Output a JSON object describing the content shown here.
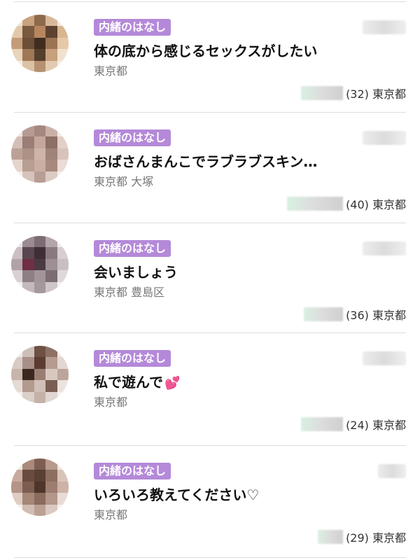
{
  "feed": {
    "items": [
      {
        "tag": "内緒のはなし",
        "title": "体の底から感じるセックスがしたい",
        "location": "東京都",
        "age_location": "(32) 東京都",
        "avatar_colors": [
          "#f0e4d6",
          "#c9a27f",
          "#8c6a4c",
          "#d9b89a",
          "#f3e9df",
          "#e3c9ac",
          "#7a5a3e",
          "#b7865f",
          "#5c4330",
          "#d8b690",
          "#c49c79",
          "#6d4e36",
          "#3f2c1e",
          "#9c7453",
          "#e6c9a8",
          "#e9d4bd",
          "#a07858",
          "#55402e",
          "#c7a07d",
          "#f1e2cf",
          "#f5ede4",
          "#dcc2a5",
          "#b59172",
          "#e2cbb2",
          "#f7efe6"
        ]
      },
      {
        "tag": "内緒のはなし",
        "title": "おばさんまんこでラブラブスキン…",
        "location": "東京都 大塚",
        "age_location": "(40) 東京都",
        "avatar_colors": [
          "#efe6e2",
          "#b69b94",
          "#a58880",
          "#c9b1a8",
          "#f2ebe8",
          "#d4bfb7",
          "#9a7d74",
          "#c5a79c",
          "#8d6f66",
          "#e1cfc8",
          "#bca198",
          "#ad9186",
          "#cdb5aa",
          "#9f847a",
          "#d8c3ba",
          "#e4d4cc",
          "#b89e93",
          "#c9afa3",
          "#a9897d",
          "#eadcd5",
          "#f4eeeb",
          "#d6c4bc",
          "#b79e94",
          "#dccbc3",
          "#f6f0ed"
        ]
      },
      {
        "tag": "内緒のはなし",
        "title": "会いましょう",
        "location": "東京都 豊島区",
        "age_location": "(36) 東京都",
        "avatar_colors": [
          "#e9e6e8",
          "#9a8c92",
          "#7e6b73",
          "#b3a6aa",
          "#eeebec",
          "#cbbfc3",
          "#5a4650",
          "#3e2f37",
          "#8a7a80",
          "#d7ced1",
          "#b1a3a8",
          "#6f2f45",
          "#4a3a42",
          "#9d8f94",
          "#c9bfc2",
          "#d8d0d3",
          "#8e7f86",
          "#a29499",
          "#7b6d73",
          "#e0d9dc",
          "#f1eef0",
          "#c4b9bd",
          "#a5989d",
          "#cfc6c9",
          "#f4f2f3"
        ]
      },
      {
        "tag": "内緒のはなし",
        "title": "私で遊んで",
        "title_emoji": "💕",
        "location": "東京都",
        "age_location": "(24) 東京都",
        "avatar_colors": [
          "#f0ebe8",
          "#cdbfb8",
          "#6e5044",
          "#8e7064",
          "#efe8e4",
          "#d8cbc4",
          "#a89088",
          "#5a3c31",
          "#b69b90",
          "#e4d7d1",
          "#c7b4ab",
          "#3b2620",
          "#9a7e73",
          "#d9c8c0",
          "#bca69c",
          "#e5dad5",
          "#b39a8f",
          "#d1c0b8",
          "#7a5e53",
          "#ece3df",
          "#f5f1ef",
          "#dcd0ca",
          "#c4b1a8",
          "#e1d6d1",
          "#f7f3f1"
        ]
      },
      {
        "tag": "内緒のはなし",
        "title": "いろいろ教えてください♡",
        "location": "東京都",
        "age_location": "(29) 東京都",
        "avatar_colors": [
          "#f0e9e5",
          "#a98a7c",
          "#7d5e50",
          "#b89a8c",
          "#eee7e3",
          "#c7ab9e",
          "#6a4c3f",
          "#5a3f33",
          "#8d6f61",
          "#d9c4ba",
          "#b39486",
          "#7c5d4f",
          "#4e3529",
          "#9c7d6f",
          "#cdb2a6",
          "#dfccc3",
          "#a58677",
          "#8a6b5d",
          "#b2978a",
          "#e8dbd5",
          "#f4eeeb",
          "#d2bdb3",
          "#bba094",
          "#dbc9c1",
          "#f6f1ee"
        ]
      }
    ]
  }
}
